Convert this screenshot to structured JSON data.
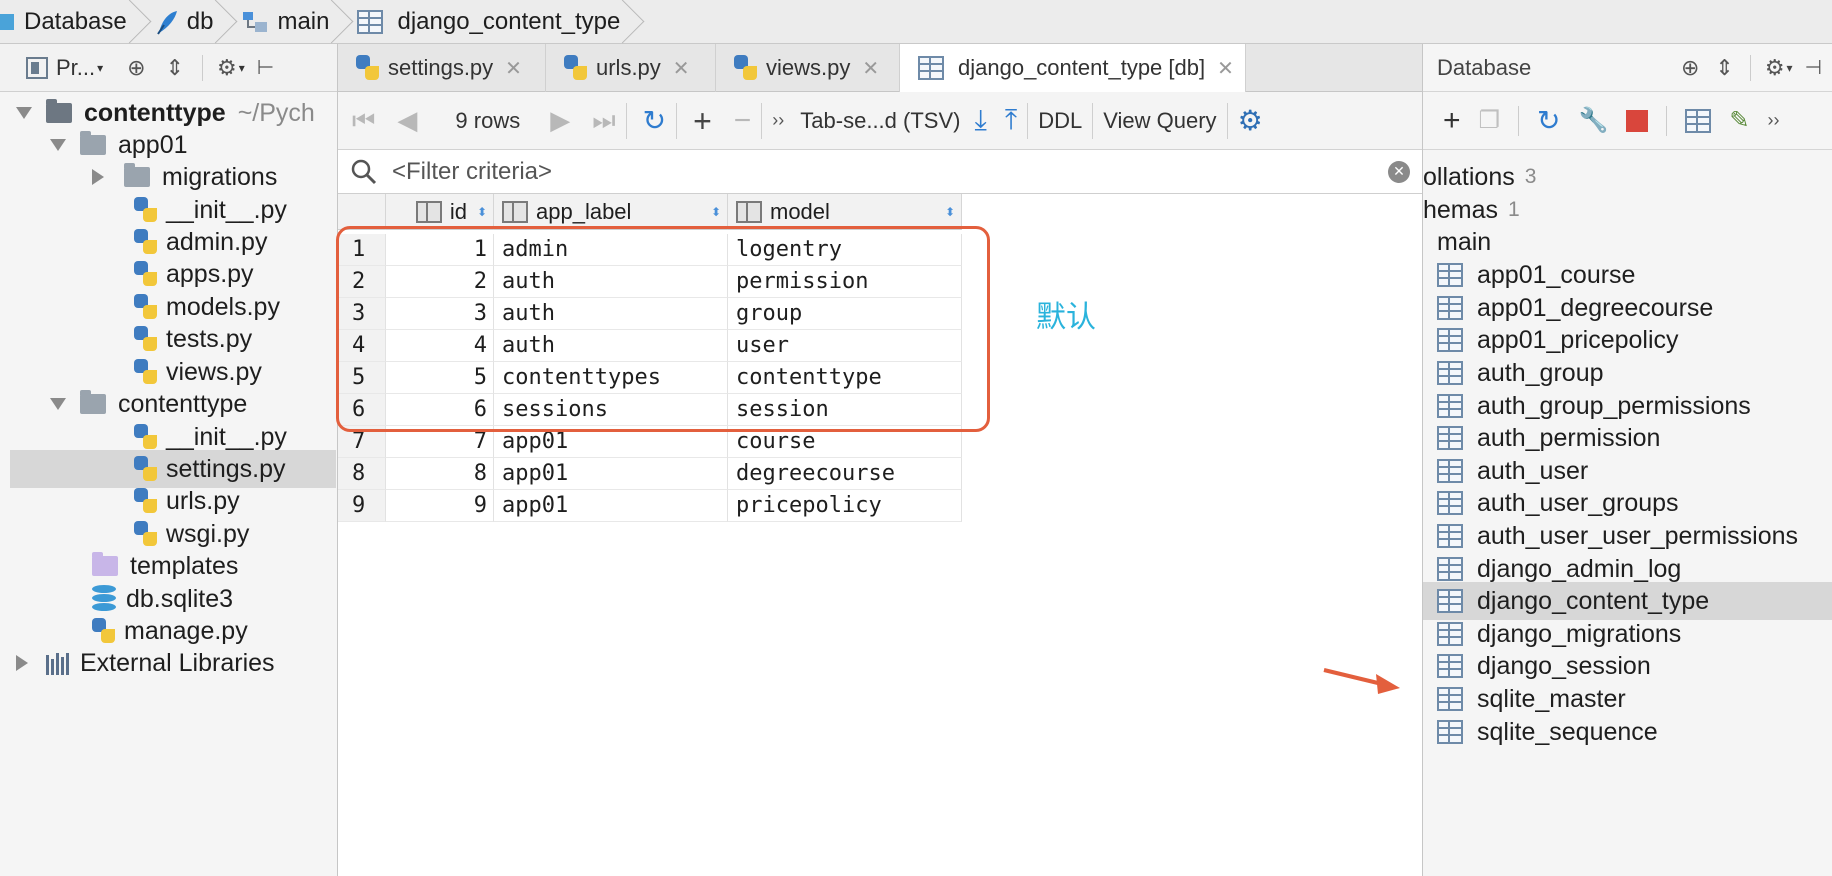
{
  "breadcrumb": [
    "Database",
    "db",
    "main",
    "django_content_type"
  ],
  "project": {
    "title": "Pr...",
    "tree": [
      {
        "label": "contenttype",
        "suffix": "~/Pych",
        "depth": 0,
        "type": "root",
        "expanded": true
      },
      {
        "label": "app01",
        "depth": 1,
        "type": "folder",
        "expanded": true
      },
      {
        "label": "migrations",
        "depth": 2,
        "type": "folder",
        "expanded": false
      },
      {
        "label": "__init__.py",
        "depth": 2,
        "type": "py"
      },
      {
        "label": "admin.py",
        "depth": 2,
        "type": "py"
      },
      {
        "label": "apps.py",
        "depth": 2,
        "type": "py"
      },
      {
        "label": "models.py",
        "depth": 2,
        "type": "py"
      },
      {
        "label": "tests.py",
        "depth": 2,
        "type": "py"
      },
      {
        "label": "views.py",
        "depth": 2,
        "type": "py"
      },
      {
        "label": "contenttype",
        "depth": 1,
        "type": "folder",
        "expanded": true
      },
      {
        "label": "__init__.py",
        "depth": 2,
        "type": "py"
      },
      {
        "label": "settings.py",
        "depth": 2,
        "type": "py",
        "selected": true
      },
      {
        "label": "urls.py",
        "depth": 2,
        "type": "py"
      },
      {
        "label": "wsgi.py",
        "depth": 2,
        "type": "py"
      },
      {
        "label": "templates",
        "depth": 1,
        "type": "purple-folder"
      },
      {
        "label": "db.sqlite3",
        "depth": 1,
        "type": "db"
      },
      {
        "label": "manage.py",
        "depth": 1,
        "type": "py"
      },
      {
        "label": "External Libraries",
        "depth": 0,
        "type": "libs",
        "expanded": false
      }
    ]
  },
  "tabs": [
    {
      "label": "settings.py",
      "type": "py"
    },
    {
      "label": "urls.py",
      "type": "py"
    },
    {
      "label": "views.py",
      "type": "py"
    },
    {
      "label": "django_content_type [db]",
      "type": "table",
      "active": true
    }
  ],
  "toolbar": {
    "rows": "9 rows",
    "format": "Tab-se...d (TSV)",
    "ddl": "DDL",
    "view_query": "View Query"
  },
  "filter": {
    "placeholder": "<Filter criteria>"
  },
  "grid": {
    "columns": [
      "id",
      "app_label",
      "model"
    ],
    "rows": [
      {
        "n": "1",
        "id": "1",
        "app_label": "admin",
        "model": "logentry"
      },
      {
        "n": "2",
        "id": "2",
        "app_label": "auth",
        "model": "permission"
      },
      {
        "n": "3",
        "id": "3",
        "app_label": "auth",
        "model": "group"
      },
      {
        "n": "4",
        "id": "4",
        "app_label": "auth",
        "model": "user"
      },
      {
        "n": "5",
        "id": "5",
        "app_label": "contenttypes",
        "model": "contenttype"
      },
      {
        "n": "6",
        "id": "6",
        "app_label": "sessions",
        "model": "session"
      },
      {
        "n": "7",
        "id": "7",
        "app_label": "app01",
        "model": "course"
      },
      {
        "n": "8",
        "id": "8",
        "app_label": "app01",
        "model": "degreecourse"
      },
      {
        "n": "9",
        "id": "9",
        "app_label": "app01",
        "model": "pricepolicy"
      }
    ]
  },
  "annotation": {
    "text": "默认",
    "color": "#2ab3dc",
    "box_color": "#e35f3d"
  },
  "database": {
    "title": "Database",
    "collations": {
      "label": "ollations",
      "count": "3"
    },
    "schemas": {
      "label": "hemas",
      "count": "1"
    },
    "schema_name": "main",
    "tables": [
      "app01_course",
      "app01_degreecourse",
      "app01_pricepolicy",
      "auth_group",
      "auth_group_permissions",
      "auth_permission",
      "auth_user",
      "auth_user_groups",
      "auth_user_user_permissions",
      "django_admin_log",
      "django_content_type",
      "django_migrations",
      "django_session",
      "sqlite_master",
      "sqlite_sequence"
    ],
    "selected_table": "django_content_type"
  }
}
